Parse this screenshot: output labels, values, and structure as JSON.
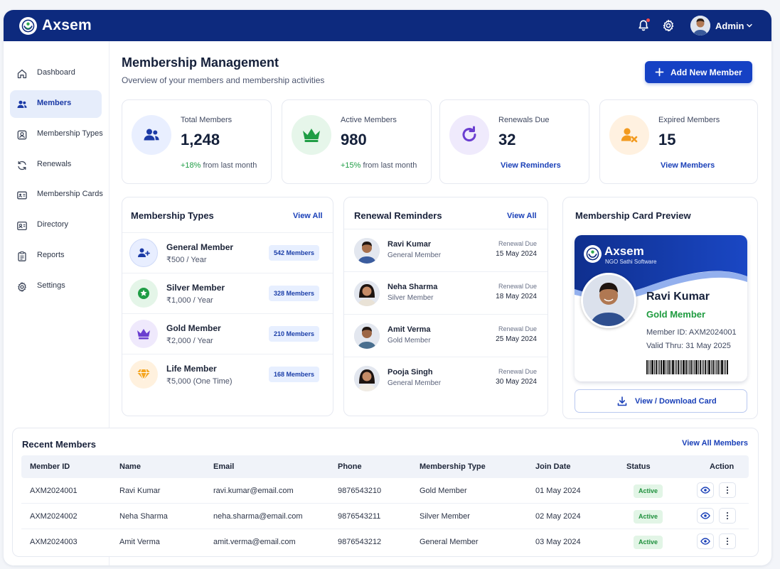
{
  "app": {
    "name": "Axsem",
    "user": "Admin"
  },
  "sidebar": {
    "items": [
      {
        "label": "Dashboard",
        "icon": "home-icon",
        "active": false
      },
      {
        "label": "Members",
        "icon": "users-icon",
        "active": true
      },
      {
        "label": "Membership Types",
        "icon": "badge-icon",
        "active": false
      },
      {
        "label": "Renewals",
        "icon": "refresh-icon",
        "active": false
      },
      {
        "label": "Membership Cards",
        "icon": "id-card-icon",
        "active": false
      },
      {
        "label": "Directory",
        "icon": "contact-card-icon",
        "active": false
      },
      {
        "label": "Reports",
        "icon": "clipboard-icon",
        "active": false
      },
      {
        "label": "Settings",
        "icon": "gear-icon",
        "active": false
      }
    ]
  },
  "header": {
    "title": "Membership Management",
    "subtitle": "Overview of your members and membership activities",
    "add_button": "Add New Member"
  },
  "stats": [
    {
      "label": "Total Members",
      "value": "1,248",
      "change": "+18%",
      "note": "from last month"
    },
    {
      "label": "Active Members",
      "value": "980",
      "change": "+15%",
      "note": "from last month"
    },
    {
      "label": "Renewals Due",
      "value": "32",
      "link": "View Reminders"
    },
    {
      "label": "Expired Members",
      "value": "15",
      "link": "View Members"
    }
  ],
  "membership_types": {
    "title": "Membership Types",
    "link": "View All",
    "items": [
      {
        "name": "General Member",
        "price": "₹500 / Year",
        "count": "542 Members"
      },
      {
        "name": "Silver Member",
        "price": "₹1,000 / Year",
        "count": "328 Members"
      },
      {
        "name": "Gold Member",
        "price": "₹2,000 / Year",
        "count": "210 Members"
      },
      {
        "name": "Life Member",
        "price": "₹5,000 (One Time)",
        "count": "168 Members"
      }
    ]
  },
  "renewals": {
    "title": "Renewal Reminders",
    "link": "View All",
    "due_label": "Renewal Due",
    "items": [
      {
        "name": "Ravi Kumar",
        "type": "General Member",
        "date": "15 May 2024"
      },
      {
        "name": "Neha Sharma",
        "type": "Silver Member",
        "date": "18 May 2024"
      },
      {
        "name": "Amit Verma",
        "type": "Gold Member",
        "date": "25 May 2024"
      },
      {
        "name": "Pooja Singh",
        "type": "General Member",
        "date": "30 May 2024"
      }
    ]
  },
  "card_preview": {
    "title": "Membership Card Preview",
    "brand": "Axsem",
    "tagline": "NGO Sathi Software",
    "name": "Ravi Kumar",
    "tier": "Gold Member",
    "member_id": "Member ID: AXM2024001",
    "valid_thru": "Valid Thru: 31 May 2025",
    "download_button": "View / Download Card"
  },
  "recent": {
    "title": "Recent Members",
    "link": "View All Members",
    "columns": [
      "Member ID",
      "Name",
      "Email",
      "Phone",
      "Membership Type",
      "Join Date",
      "Status",
      "Action"
    ],
    "rows": [
      {
        "id": "AXM2024001",
        "name": "Ravi Kumar",
        "email": "ravi.kumar@email.com",
        "phone": "9876543210",
        "type": "Gold Member",
        "date": "01 May 2024",
        "status": "Active"
      },
      {
        "id": "AXM2024002",
        "name": "Neha Sharma",
        "email": "neha.sharma@email.com",
        "phone": "9876543211",
        "type": "Silver Member",
        "date": "02 May 2024",
        "status": "Active"
      },
      {
        "id": "AXM2024003",
        "name": "Amit Verma",
        "email": "amit.verma@email.com",
        "phone": "9876543212",
        "type": "General Member",
        "date": "03 May 2024",
        "status": "Active"
      }
    ]
  },
  "colors": {
    "topbar": "#0d2a7e",
    "primary": "#1541c4",
    "positive": "#1f9d45",
    "gold_text": "#1e9b3f",
    "active_nav": "#e6edfb"
  }
}
